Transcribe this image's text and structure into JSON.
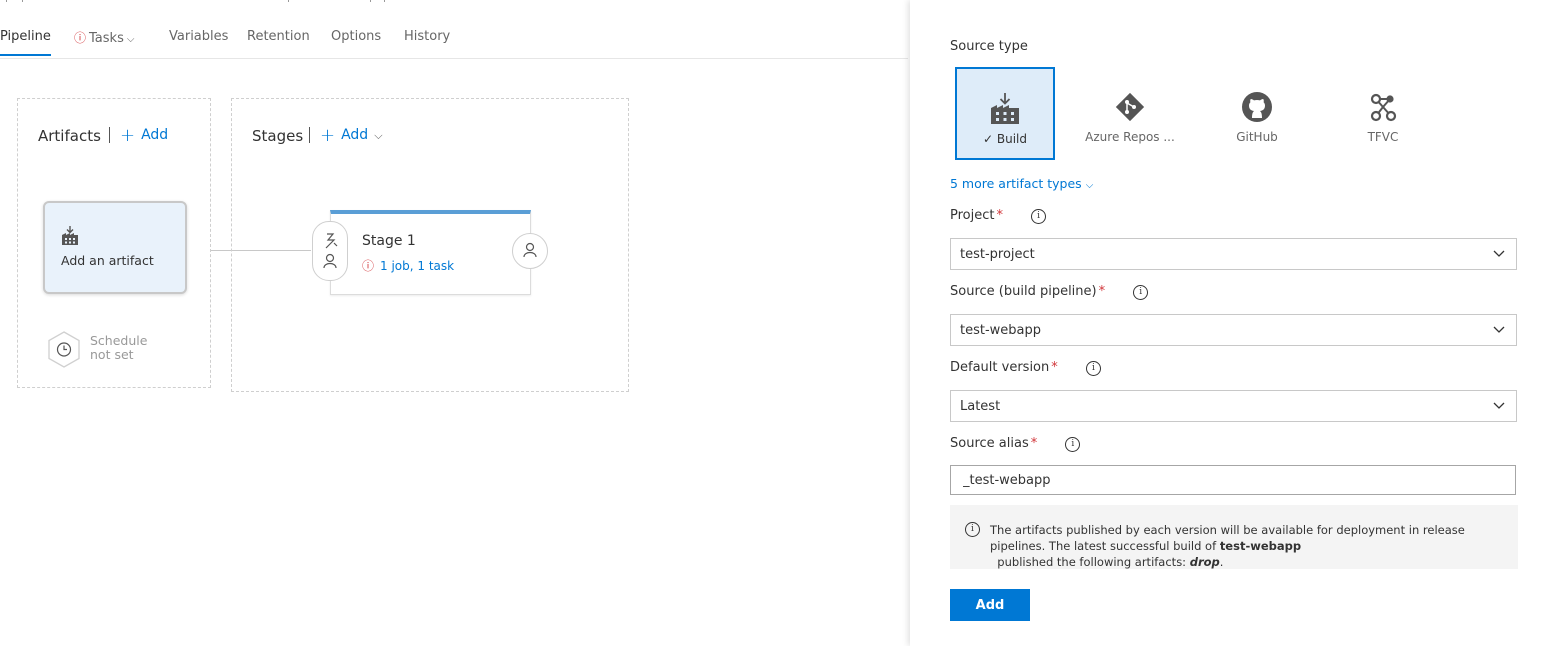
{
  "tabs": {
    "pipeline": "Pipeline",
    "tasks": "Tasks",
    "variables": "Variables",
    "retention": "Retention",
    "options": "Options",
    "history": "History"
  },
  "artifacts": {
    "title": "Artifacts",
    "add_label": "Add",
    "card_label": "Add an artifact",
    "schedule_line1": "Schedule",
    "schedule_line2": "not set"
  },
  "stages": {
    "title": "Stages",
    "add_label": "Add",
    "stage_name": "Stage 1",
    "stage_summary": "1 job, 1 task"
  },
  "side_panel": {
    "source_type_label": "Source type",
    "source_types": [
      {
        "label": "Build",
        "selected": true,
        "icon": "build-icon"
      },
      {
        "label": "Azure Repos ...",
        "selected": false,
        "icon": "azure-repos-icon"
      },
      {
        "label": "GitHub",
        "selected": false,
        "icon": "github-icon"
      },
      {
        "label": "TFVC",
        "selected": false,
        "icon": "tfvc-icon"
      }
    ],
    "more_types": "5 more artifact types",
    "project_label": "Project",
    "project_value": "test-project",
    "source_label": "Source (build pipeline)",
    "source_value": "test-webapp",
    "version_label": "Default version",
    "version_value": "Latest",
    "alias_label": "Source alias",
    "alias_value": "_test-webapp",
    "required_mark": "*",
    "note_part1": "The artifacts published by each version will be available for deployment in release pipelines. The latest successful build of ",
    "note_bold": "test-webapp",
    "note_part2": "  published the following artifacts: ",
    "note_italic": "drop",
    "note_end": ".",
    "add_button": "Add"
  },
  "colors": {
    "accent": "#0078d4",
    "warning": "#d13438",
    "selected_tile": "#deecf9"
  }
}
